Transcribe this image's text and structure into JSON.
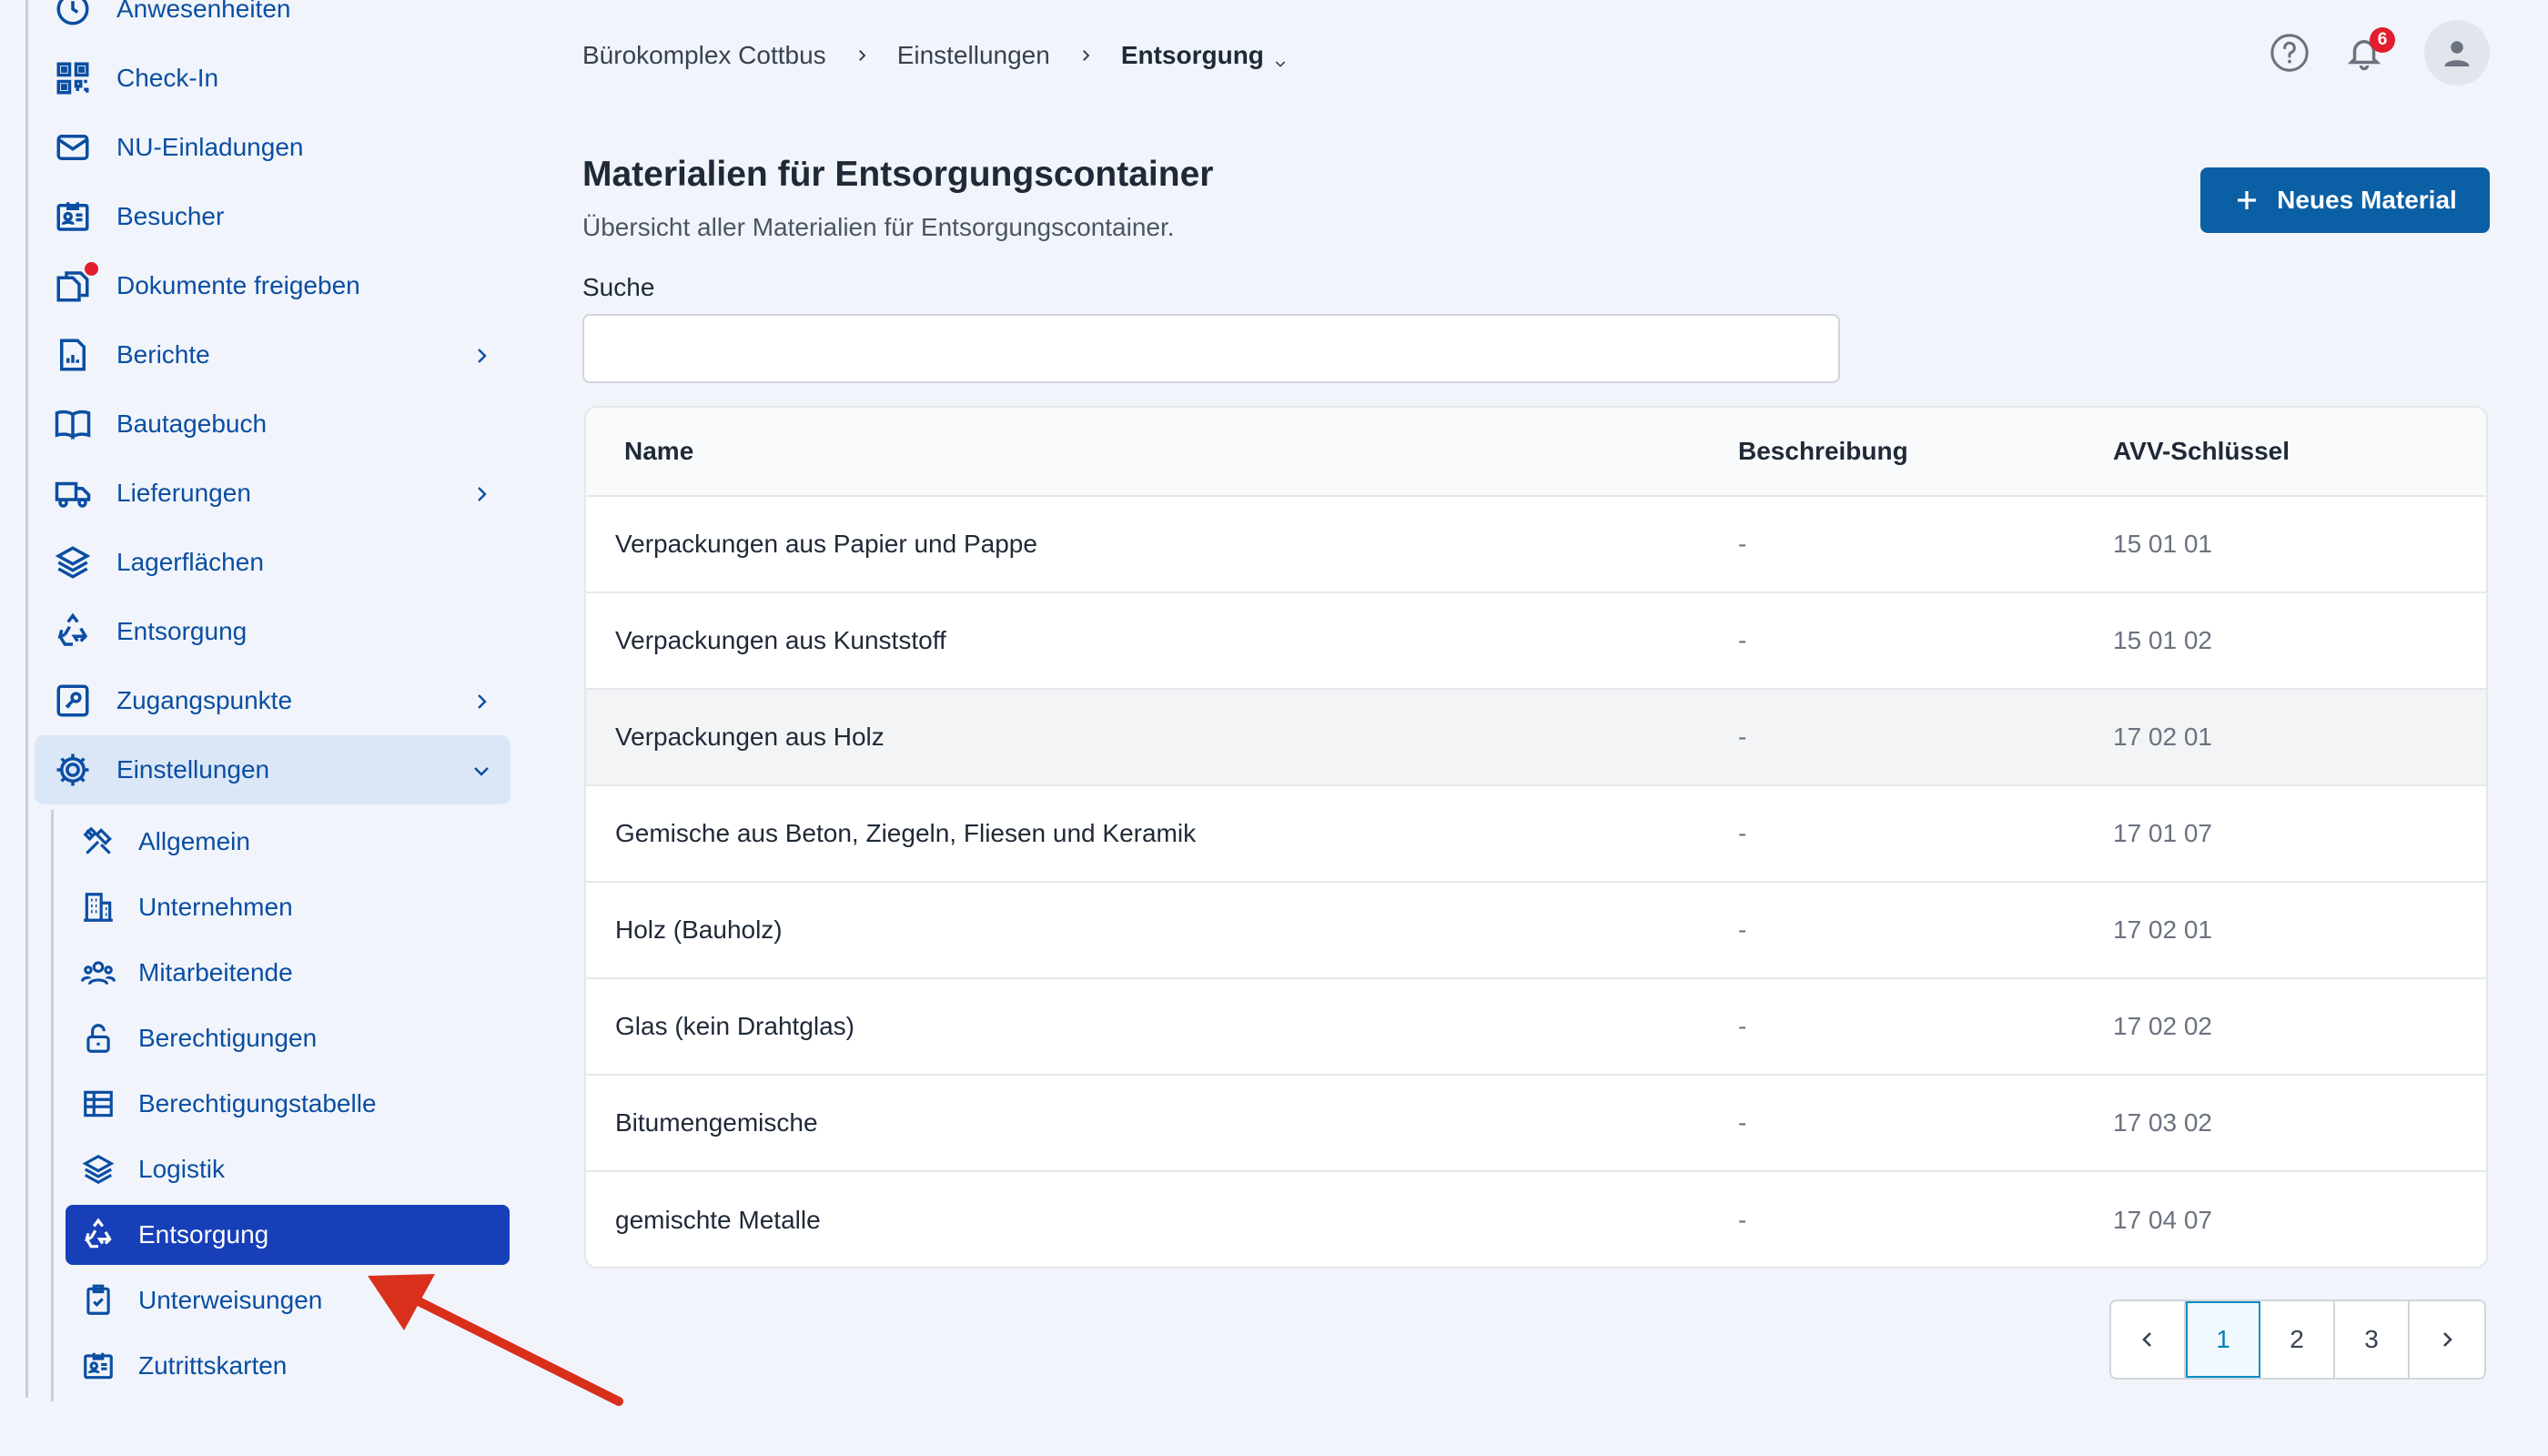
{
  "sidebar": {
    "items": [
      {
        "label": "Anwesenheiten",
        "icon": "clock-icon"
      },
      {
        "label": "Check-In",
        "icon": "qr-code-icon"
      },
      {
        "label": "NU-Einladungen",
        "icon": "envelope-icon"
      },
      {
        "label": "Besucher",
        "icon": "id-card-icon"
      },
      {
        "label": "Dokumente freigeben",
        "icon": "documents-icon",
        "notification_dot": true
      },
      {
        "label": "Berichte",
        "icon": "report-icon",
        "has_submenu": true
      },
      {
        "label": "Bautagebuch",
        "icon": "book-icon"
      },
      {
        "label": "Lieferungen",
        "icon": "truck-icon",
        "has_submenu": true
      },
      {
        "label": "Lagerflächen",
        "icon": "layers-icon"
      },
      {
        "label": "Entsorgung",
        "icon": "recycle-icon"
      },
      {
        "label": "Zugangspunkte",
        "icon": "key-icon",
        "has_submenu": true
      },
      {
        "label": "Einstellungen",
        "icon": "gear-icon",
        "expanded": true
      }
    ],
    "subitems": [
      {
        "label": "Allgemein",
        "icon": "tools-icon"
      },
      {
        "label": "Unternehmen",
        "icon": "building-icon"
      },
      {
        "label": "Mitarbeitende",
        "icon": "users-icon"
      },
      {
        "label": "Berechtigungen",
        "icon": "unlock-icon"
      },
      {
        "label": "Berechtigungstabelle",
        "icon": "table-icon"
      },
      {
        "label": "Logistik",
        "icon": "layers-icon"
      },
      {
        "label": "Entsorgung",
        "icon": "recycle-icon",
        "active": true
      },
      {
        "label": "Unterweisungen",
        "icon": "clipboard-check-icon"
      },
      {
        "label": "Zutrittskarten",
        "icon": "id-card-icon"
      }
    ]
  },
  "breadcrumb": {
    "project": "Bürokomplex Cottbus",
    "section": "Einstellungen",
    "current": "Entsorgung"
  },
  "header": {
    "notification_count": "6"
  },
  "main": {
    "title": "Materialien für Entsorgungscontainer",
    "subtitle": "Übersicht aller Materialien für Entsorgungscontainer.",
    "new_button_label": "Neues Material",
    "search_label": "Suche",
    "search_value": "",
    "search_placeholder": ""
  },
  "table": {
    "columns": [
      "Name",
      "Beschreibung",
      "AVV-Schlüssel"
    ],
    "rows": [
      {
        "name": "Verpackungen aus Papier und Pappe",
        "description": "-",
        "avv": "15 01 01"
      },
      {
        "name": "Verpackungen aus Kunststoff",
        "description": "-",
        "avv": "15 01 02"
      },
      {
        "name": "Verpackungen aus Holz",
        "description": "-",
        "avv": "17 02 01"
      },
      {
        "name": "Gemische aus Beton, Ziegeln, Fliesen und Keramik",
        "description": "-",
        "avv": "17 01 07"
      },
      {
        "name": "Holz (Bauholz)",
        "description": "-",
        "avv": "17 02 01"
      },
      {
        "name": "Glas (kein Drahtglas)",
        "description": "-",
        "avv": "17 02 02"
      },
      {
        "name": "Bitumengemische",
        "description": "-",
        "avv": "17 03 02"
      },
      {
        "name": "gemischte Metalle",
        "description": "-",
        "avv": "17 04 07"
      }
    ]
  },
  "pagination": {
    "pages": [
      "1",
      "2",
      "3"
    ],
    "current": "1"
  },
  "colors": {
    "accent": "#0b5fa5",
    "active_nav": "#173fb8",
    "nav_text": "#0b4ea2",
    "badge": "#e11d2e",
    "annotation_arrow": "#d9301c"
  }
}
